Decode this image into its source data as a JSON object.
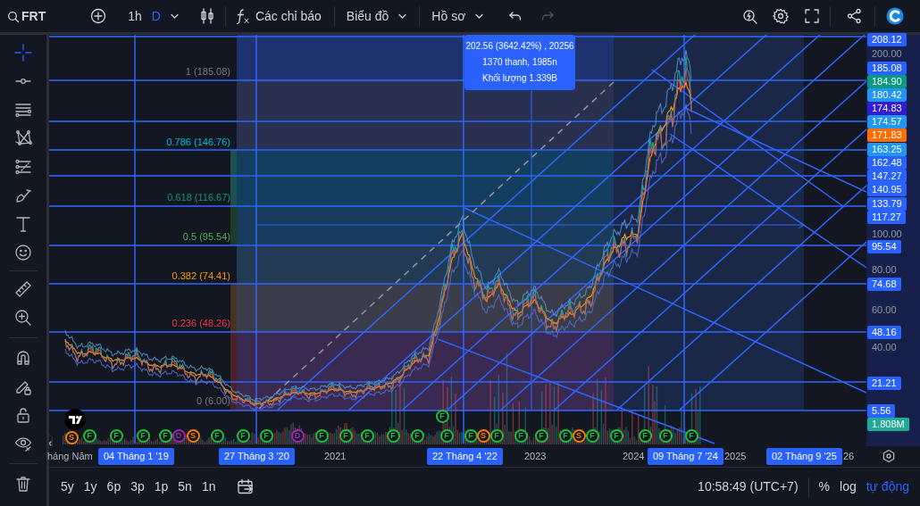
{
  "top_bar": {
    "symbol": "FRT",
    "intervals": [
      {
        "label": "1h",
        "selected": false
      },
      {
        "label": "D",
        "selected": true
      }
    ],
    "indicators": "Các chỉ báo",
    "menus": [
      "Biểu đồ",
      "Hồ sơ"
    ],
    "history_buttons": [
      {
        "kind": "undo",
        "disabled": false
      },
      {
        "kind": "redo",
        "disabled": true
      }
    ]
  },
  "drawing_tools": [
    {
      "kind": "crosshair",
      "selected": true
    },
    {
      "kind": "line",
      "selected": false
    },
    {
      "kind": "parallel",
      "selected": false
    },
    {
      "kind": "pattern",
      "selected": false
    },
    {
      "kind": "fib",
      "selected": false
    },
    {
      "kind": "brush",
      "selected": false
    },
    {
      "kind": "text",
      "selected": false
    },
    {
      "kind": "emoji",
      "selected": false
    },
    {
      "kind": "ruler",
      "selected": false
    },
    {
      "kind": "zoom",
      "selected": false
    },
    {
      "kind": "magnet",
      "selected": false
    },
    {
      "kind": "pencil-lock",
      "selected": false
    },
    {
      "kind": "lock",
      "selected": false
    },
    {
      "kind": "eye",
      "selected": false
    },
    {
      "kind": "trash",
      "selected": false
    }
  ],
  "fib_levels": [
    {
      "label": "1 (185.08)",
      "color": "#787b86"
    },
    {
      "label": "0.786 (146.76)",
      "color": "#00bcd4"
    },
    {
      "label": "0.618 (116.67)",
      "color": "#089981"
    },
    {
      "label": "0.5 (95.54)",
      "color": "#4caf50"
    },
    {
      "label": "0.382 (74.41)",
      "color": "#ff9800"
    },
    {
      "label": "0.236 (48.26)",
      "color": "#f23645"
    },
    {
      "label": "0 (6.00)",
      "color": "#787b86"
    }
  ],
  "tooltip": [
    "202.56 (3642.42%) , 20256",
    "1370 thanh, 1985n",
    "Khối lượng 1.339B"
  ],
  "events": [
    {
      "label": "S",
      "color": "#f57c00"
    },
    {
      "label": "F",
      "color": "#1fbf3a"
    },
    {
      "label": "F",
      "color": "#1fbf3a"
    },
    {
      "label": "F",
      "color": "#1fbf3a"
    },
    {
      "label": "F",
      "color": "#1fbf3a"
    },
    {
      "label": "D",
      "color": "#9c27b0"
    },
    {
      "label": "S",
      "color": "#f57c00"
    },
    {
      "label": "F",
      "color": "#1fbf3a"
    },
    {
      "label": "F",
      "color": "#1fbf3a"
    },
    {
      "label": "F",
      "color": "#1fbf3a"
    },
    {
      "label": "D",
      "color": "#9c27b0"
    },
    {
      "label": "F",
      "color": "#1fbf3a"
    },
    {
      "label": "F",
      "color": "#1fbf3a"
    },
    {
      "label": "F",
      "color": "#1fbf3a"
    },
    {
      "label": "F",
      "color": "#1fbf3a"
    },
    {
      "label": "F",
      "color": "#1fbf3a"
    },
    {
      "label": "F",
      "color": "#1fbf3a"
    },
    {
      "label": "F",
      "color": "#1fbf3a"
    },
    {
      "label": "F",
      "color": "#1fbf3a"
    },
    {
      "label": "S",
      "color": "#f57c00"
    },
    {
      "label": "F",
      "color": "#1fbf3a"
    },
    {
      "label": "F",
      "color": "#1fbf3a"
    },
    {
      "label": "F",
      "color": "#1fbf3a"
    },
    {
      "label": "F",
      "color": "#1fbf3a"
    },
    {
      "label": "S",
      "color": "#f57c00"
    },
    {
      "label": "F",
      "color": "#1fbf3a"
    },
    {
      "label": "F",
      "color": "#1fbf3a"
    },
    {
      "label": "F",
      "color": "#1fbf3a"
    },
    {
      "label": "F",
      "color": "#1fbf3a"
    },
    {
      "label": "F",
      "color": "#1fbf3a"
    }
  ],
  "price_axis": [
    {
      "text": "208.12",
      "kind": "marker",
      "color": "#2962ff"
    },
    {
      "text": "200.00",
      "kind": "tick"
    },
    {
      "text": "185.08",
      "kind": "marker",
      "color": "#2962ff"
    },
    {
      "text": "184.90",
      "kind": "marker",
      "color": "#089981"
    },
    {
      "text": "180.42",
      "kind": "marker",
      "color": "#2196f3"
    },
    {
      "text": "174.83",
      "kind": "marker",
      "color": "#311bd6"
    },
    {
      "text": "174.57",
      "kind": "marker",
      "color": "#2196f3"
    },
    {
      "text": "171.83",
      "kind": "marker",
      "color": "#ff6d00"
    },
    {
      "text": "163.25",
      "kind": "marker",
      "color": "#2196f3"
    },
    {
      "text": "162.48",
      "kind": "marker",
      "color": "#2962ff"
    },
    {
      "text": "147.27",
      "kind": "marker",
      "color": "#2962ff"
    },
    {
      "text": "140.95",
      "kind": "marker",
      "color": "#2962ff"
    },
    {
      "text": "133.79",
      "kind": "marker",
      "color": "#2962ff"
    },
    {
      "text": "117.27",
      "kind": "marker",
      "color": "#2962ff"
    },
    {
      "text": "100.00",
      "kind": "tick"
    },
    {
      "text": "95.54",
      "kind": "marker",
      "color": "#2962ff"
    },
    {
      "text": "80.00",
      "kind": "tick"
    },
    {
      "text": "74.68",
      "kind": "marker",
      "color": "#2962ff"
    },
    {
      "text": "60.00",
      "kind": "tick"
    },
    {
      "text": "48.16",
      "kind": "marker",
      "color": "#2962ff"
    },
    {
      "text": "40.00",
      "kind": "tick"
    },
    {
      "text": "21.21",
      "kind": "marker",
      "color": "#2962ff"
    },
    {
      "text": "5.56",
      "kind": "marker",
      "color": "#2962ff"
    },
    {
      "text": "1.808M",
      "kind": "marker",
      "color": "#22ab94"
    }
  ],
  "time_axis": [
    {
      "text": "háng Năm",
      "kind": "tick"
    },
    {
      "text": "04 Tháng 1 '19",
      "kind": "marker"
    },
    {
      "text": "27 Tháng 3 '20",
      "kind": "marker"
    },
    {
      "text": "2021",
      "kind": "tick"
    },
    {
      "text": "22 Tháng 4 '22",
      "kind": "marker"
    },
    {
      "text": "2023",
      "kind": "tick"
    },
    {
      "text": "2024",
      "kind": "tick"
    },
    {
      "text": "09 Tháng 7 '24",
      "kind": "marker"
    },
    {
      "text": "2025",
      "kind": "tick"
    },
    {
      "text": "02 Tháng 9 '25",
      "kind": "marker"
    },
    {
      "text": "26",
      "kind": "tick"
    }
  ],
  "range_buttons": [
    "5y",
    "1y",
    "6p",
    "3p",
    "1p",
    "5n",
    "1n"
  ],
  "clock": "10:58:49 (UTC+7)",
  "scale_buttons": [
    {
      "label": "%",
      "on": false
    },
    {
      "label": "log",
      "on": false
    },
    {
      "label": "tự động",
      "on": true
    }
  ]
}
